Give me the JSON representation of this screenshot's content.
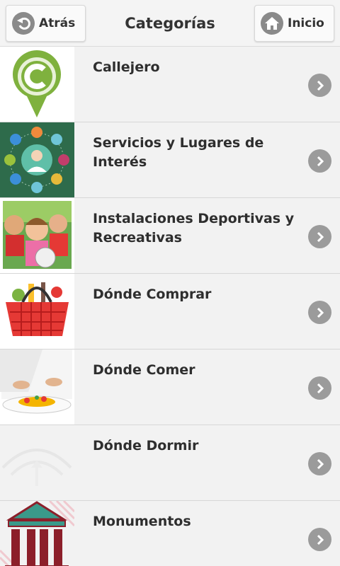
{
  "header": {
    "back_label": "Atrás",
    "title": "Categorías",
    "home_label": "Inicio"
  },
  "categories": [
    {
      "label": "Callejero",
      "thumb": "map-pin-c-icon"
    },
    {
      "label": "Servicios y Lugares de Interés",
      "thumb": "services-network-icon"
    },
    {
      "label": "Instalaciones Deportivas y Recreativas",
      "thumb": "children-photo"
    },
    {
      "label": "Dónde Comprar",
      "thumb": "shopping-basket-photo"
    },
    {
      "label": "Dónde Comer",
      "thumb": "chef-plating-photo"
    },
    {
      "label": "Dónde Dormir",
      "thumb": "faded-logo-placeholder"
    },
    {
      "label": "Monumentos",
      "thumb": "monument-icon"
    }
  ],
  "colors": {
    "accent_green": "#7fb13e",
    "dark_green": "#2e6b4b",
    "chevron_gray": "#9b9b9b",
    "monument_teal": "#3a9a8a",
    "monument_red": "#8c1f2a"
  }
}
